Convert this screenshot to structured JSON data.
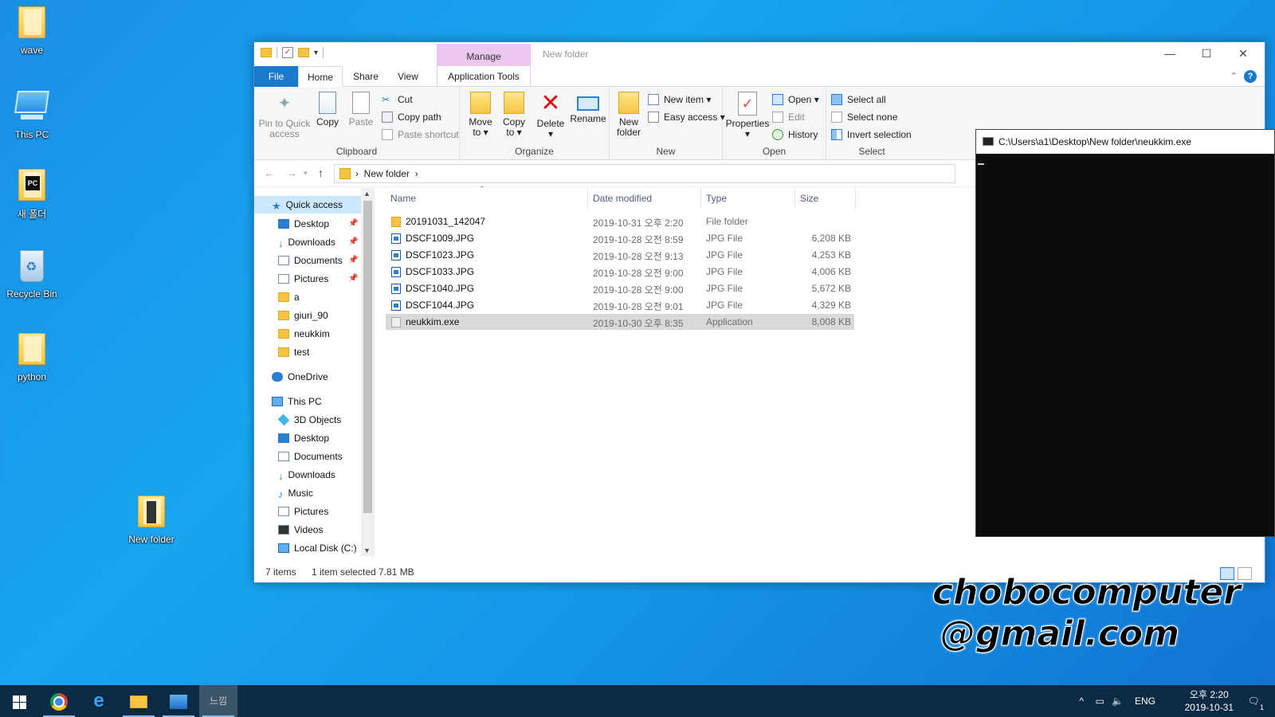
{
  "desktop": {
    "icons": [
      {
        "label": "wave",
        "icon": "folder-icon"
      },
      {
        "label": "This PC",
        "icon": "computer-icon"
      },
      {
        "label": "새 폴더",
        "icon": "pycharm-icon"
      },
      {
        "label": "Recycle Bin",
        "icon": "recycle-bin-icon"
      },
      {
        "label": "python",
        "icon": "folder-icon"
      },
      {
        "label": "New folder",
        "icon": "folder-icon"
      }
    ]
  },
  "explorer": {
    "title": "New folder",
    "manage_label": "Manage",
    "tabs": [
      "File",
      "Home",
      "Share",
      "View",
      "Application Tools"
    ],
    "ribbon": {
      "clipboard": {
        "group_label": "Clipboard",
        "pin": "Pin to Quick access",
        "pin_l1": "Pin to Quick",
        "pin_l2": "access",
        "copy": "Copy",
        "paste": "Paste",
        "cut": "Cut",
        "copy_path": "Copy path",
        "paste_shortcut": "Paste shortcut"
      },
      "organize": {
        "group_label": "Organize",
        "move_l1": "Move",
        "move_l2": "to ▾",
        "copyto_l1": "Copy",
        "copyto_l2": "to ▾",
        "delete_l1": "Delete",
        "delete_l2": "▾",
        "rename": "Rename"
      },
      "new": {
        "group_label": "New",
        "new_folder_l1": "New",
        "new_folder_l2": "folder",
        "new_item": "New item ▾",
        "easy_access": "Easy access ▾"
      },
      "open": {
        "group_label": "Open",
        "properties_l1": "Properties",
        "properties_l2": "▾",
        "open": "Open ▾",
        "edit": "Edit",
        "history": "History"
      },
      "select": {
        "group_label": "Select",
        "select_all": "Select all",
        "select_none": "Select none",
        "invert": "Invert selection"
      }
    },
    "address": {
      "path": "New folder",
      "separator": "›"
    },
    "nav": {
      "quick_access": "Quick access",
      "quick_items": [
        "Desktop",
        "Downloads",
        "Documents",
        "Pictures",
        "a",
        "giuri_90",
        "neukkim",
        "test"
      ],
      "onedrive": "OneDrive",
      "this_pc": "This PC",
      "pc_items": [
        "3D Objects",
        "Desktop",
        "Documents",
        "Downloads",
        "Music",
        "Pictures",
        "Videos",
        "Local Disk (C:)"
      ]
    },
    "columns": {
      "name": "Name",
      "date": "Date modified",
      "type": "Type",
      "size": "Size"
    },
    "files": [
      {
        "name": "20191031_142047",
        "date": "2019-10-31 오후 2:20",
        "type": "File folder",
        "size": "",
        "kind": "folder"
      },
      {
        "name": "DSCF1009.JPG",
        "date": "2019-10-28 오전 8:59",
        "type": "JPG File",
        "size": "6,208 KB",
        "kind": "jpg"
      },
      {
        "name": "DSCF1023.JPG",
        "date": "2019-10-28 오전 9:13",
        "type": "JPG File",
        "size": "4,253 KB",
        "kind": "jpg"
      },
      {
        "name": "DSCF1033.JPG",
        "date": "2019-10-28 오전 9:00",
        "type": "JPG File",
        "size": "4,006 KB",
        "kind": "jpg"
      },
      {
        "name": "DSCF1040.JPG",
        "date": "2019-10-28 오전 9:00",
        "type": "JPG File",
        "size": "5,672 KB",
        "kind": "jpg"
      },
      {
        "name": "DSCF1044.JPG",
        "date": "2019-10-28 오전 9:01",
        "type": "JPG File",
        "size": "4,329 KB",
        "kind": "jpg"
      },
      {
        "name": "neukkim.exe",
        "date": "2019-10-30 오후 8:35",
        "type": "Application",
        "size": "8,008 KB",
        "kind": "exe",
        "selected": true
      }
    ],
    "status": {
      "items": "7 items",
      "selected": "1 item selected",
      "size": "7.81 MB"
    }
  },
  "console": {
    "title": "C:\\Users\\a1\\Desktop\\New folder\\neukkim.exe"
  },
  "watermark": {
    "line1": "chobocomputer",
    "line2": "@gmail.com"
  },
  "taskbar": {
    "active_app": "느낌",
    "lang": "ENG",
    "time": "오후 2:20",
    "date": "2019-10-31",
    "notif_count": "1"
  }
}
